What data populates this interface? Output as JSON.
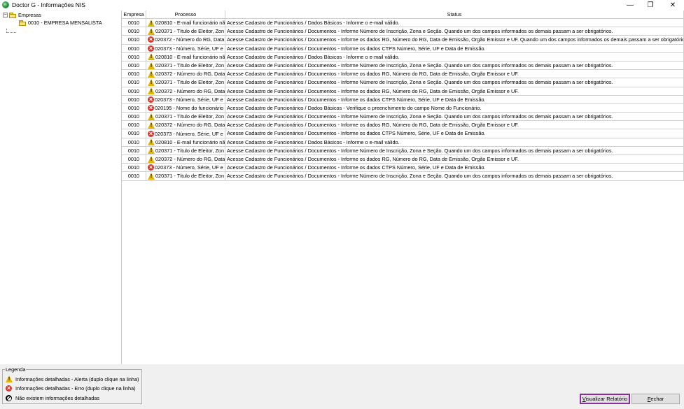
{
  "window": {
    "title": "Doctor G - Informações NIS",
    "minimize_glyph": "—",
    "restore_glyph": "❐",
    "close_glyph": "✕"
  },
  "tree": {
    "root_label": "Empresas",
    "root_expander": "−",
    "child_label": "0010  - EMPRESA MENSALISTA"
  },
  "grid": {
    "columns": [
      "Empresa",
      "Processo",
      "Status"
    ],
    "rows": [
      {
        "empresa": "0010",
        "icon": "warn",
        "processo": "020810 - E-mail funcionário nã",
        "status": "Acesse Cadastro de Funcionários / Dados Básicos - Informe o e-mail válido."
      },
      {
        "empresa": "0010",
        "icon": "warn",
        "processo": "020371 - Título de Eleitor, Zon",
        "status": "Acesse Cadastro de Funcionários / Documentos - Informe Número de Inscrição, Zona e Seção. Quando um dos campos informados os demais passam a ser obrigatórios."
      },
      {
        "empresa": "0010",
        "icon": "err",
        "processo": "020372 - Número do RG, Data",
        "status": "Acesse Cadastro de Funcionários / Documentos - Informe os dados RG, Número do RG, Data de Emissão, Orgão Emissor e UF. Quando um dos campos informados os demais passam a ser obrigatórios."
      },
      {
        "empresa": "0010",
        "icon": "err",
        "processo": "020373 - Número, Série, UF e",
        "status": "Acesse Cadastro de Funcionários / Documentos - Informe os dados CTPS Número, Série, UF e Data de Emissão."
      },
      {
        "empresa": "0010",
        "icon": "warn",
        "processo": "020810 - E-mail funcionário nã",
        "status": "Acesse Cadastro de Funcionários / Dados Básicos - Informe o e-mail válido."
      },
      {
        "empresa": "0010",
        "icon": "warn",
        "processo": "020371 - Título de Eleitor, Zon",
        "status": "Acesse Cadastro de Funcionários / Documentos - Informe Número de Inscrição, Zona e Seção. Quando um dos campos informados os demais passam a ser obrigatórios."
      },
      {
        "empresa": "0010",
        "icon": "warn",
        "processo": "020372 - Número do RG, Data",
        "status": "Acesse Cadastro de Funcionários / Documentos - Informe os dados RG, Número do RG, Data de Emissão, Orgão Emissor e UF."
      },
      {
        "empresa": "0010",
        "icon": "warn",
        "processo": "020371 - Título de Eleitor, Zon",
        "status": "Acesse Cadastro de Funcionários / Documentos - Informe Número de Inscrição, Zona e Seção. Quando um dos campos informados os demais passam a ser obrigatórios."
      },
      {
        "empresa": "0010",
        "icon": "warn",
        "processo": "020372 - Número do RG, Data",
        "status": "Acesse Cadastro de Funcionários / Documentos - Informe os dados RG, Número do RG, Data de Emissão, Orgão Emissor e UF."
      },
      {
        "empresa": "0010",
        "icon": "err",
        "processo": "020373 - Número, Série, UF e",
        "status": "Acesse Cadastro de Funcionários / Documentos - Informe os dados CTPS Número, Série, UF e Data de Emissão."
      },
      {
        "empresa": "0010",
        "icon": "err",
        "processo": "020195 - Nome do funcionário",
        "status": "Acesse Cadastro de Funcionários / Dados Básicos - Verifique o preenchimento do campo Nome do Funcionário."
      },
      {
        "empresa": "0010",
        "icon": "warn",
        "processo": "020371 - Título de Eleitor, Zon",
        "status": "Acesse Cadastro de Funcionários / Documentos - Informe Número de Inscrição, Zona e Seção. Quando um dos campos informados os demais passam a ser obrigatórios."
      },
      {
        "empresa": "0010",
        "icon": "warn",
        "processo": "020372 - Número do RG, Data",
        "status": "Acesse Cadastro de Funcionários / Documentos - Informe os dados RG, Número do RG, Data de Emissão, Orgão Emissor e UF."
      },
      {
        "empresa": "0010",
        "icon": "err",
        "processo": "020373 - Número, Série, UF e",
        "status": "Acesse Cadastro de Funcionários / Documentos - Informe os dados CTPS Número, Série, UF e Data de Emissão."
      },
      {
        "empresa": "0010",
        "icon": "warn",
        "processo": "020810 - E-mail funcionário nã",
        "status": "Acesse Cadastro de Funcionários / Dados Básicos - Informe o e-mail válido."
      },
      {
        "empresa": "0010",
        "icon": "warn",
        "processo": "020371 - Título de Eleitor, Zon",
        "status": "Acesse Cadastro de Funcionários / Documentos - Informe Número de Inscrição, Zona e Seção. Quando um dos campos informados os demais passam a ser obrigatórios."
      },
      {
        "empresa": "0010",
        "icon": "warn",
        "processo": "020372 - Número do RG, Data",
        "status": "Acesse Cadastro de Funcionários / Documentos - Informe os dados RG, Número do RG, Data de Emissão, Orgão Emissor e UF."
      },
      {
        "empresa": "0010",
        "icon": "err",
        "processo": "020373 - Número, Série, UF e",
        "status": "Acesse Cadastro de Funcionários / Documentos - Informe os dados CTPS Número, Série, UF e Data de Emissão."
      },
      {
        "empresa": "0010",
        "icon": "warn",
        "processo": "020371 - Título de Eleitor, Zon",
        "status": "Acesse Cadastro de Funcionários / Documentos - Informe Número de Inscrição, Zona e Seção. Quando um dos campos informados os demais passam a ser obrigatórios."
      }
    ]
  },
  "legend": {
    "title": "Legenda",
    "alert": "Informações detalhadas - Alerta (duplo clique na linha)",
    "error": "Informações detalhadas - Erro    (duplo clique na linha)",
    "none": "Não existem informações detalhadas"
  },
  "buttons": {
    "report_mnemonic": "V",
    "report_rest": "isualizar Relatório",
    "close_mnemonic": "F",
    "close_rest": "echar"
  },
  "colors": {
    "warning": "#e3b600",
    "error": "#d9342b",
    "focus_border": "#8b2f9a"
  }
}
